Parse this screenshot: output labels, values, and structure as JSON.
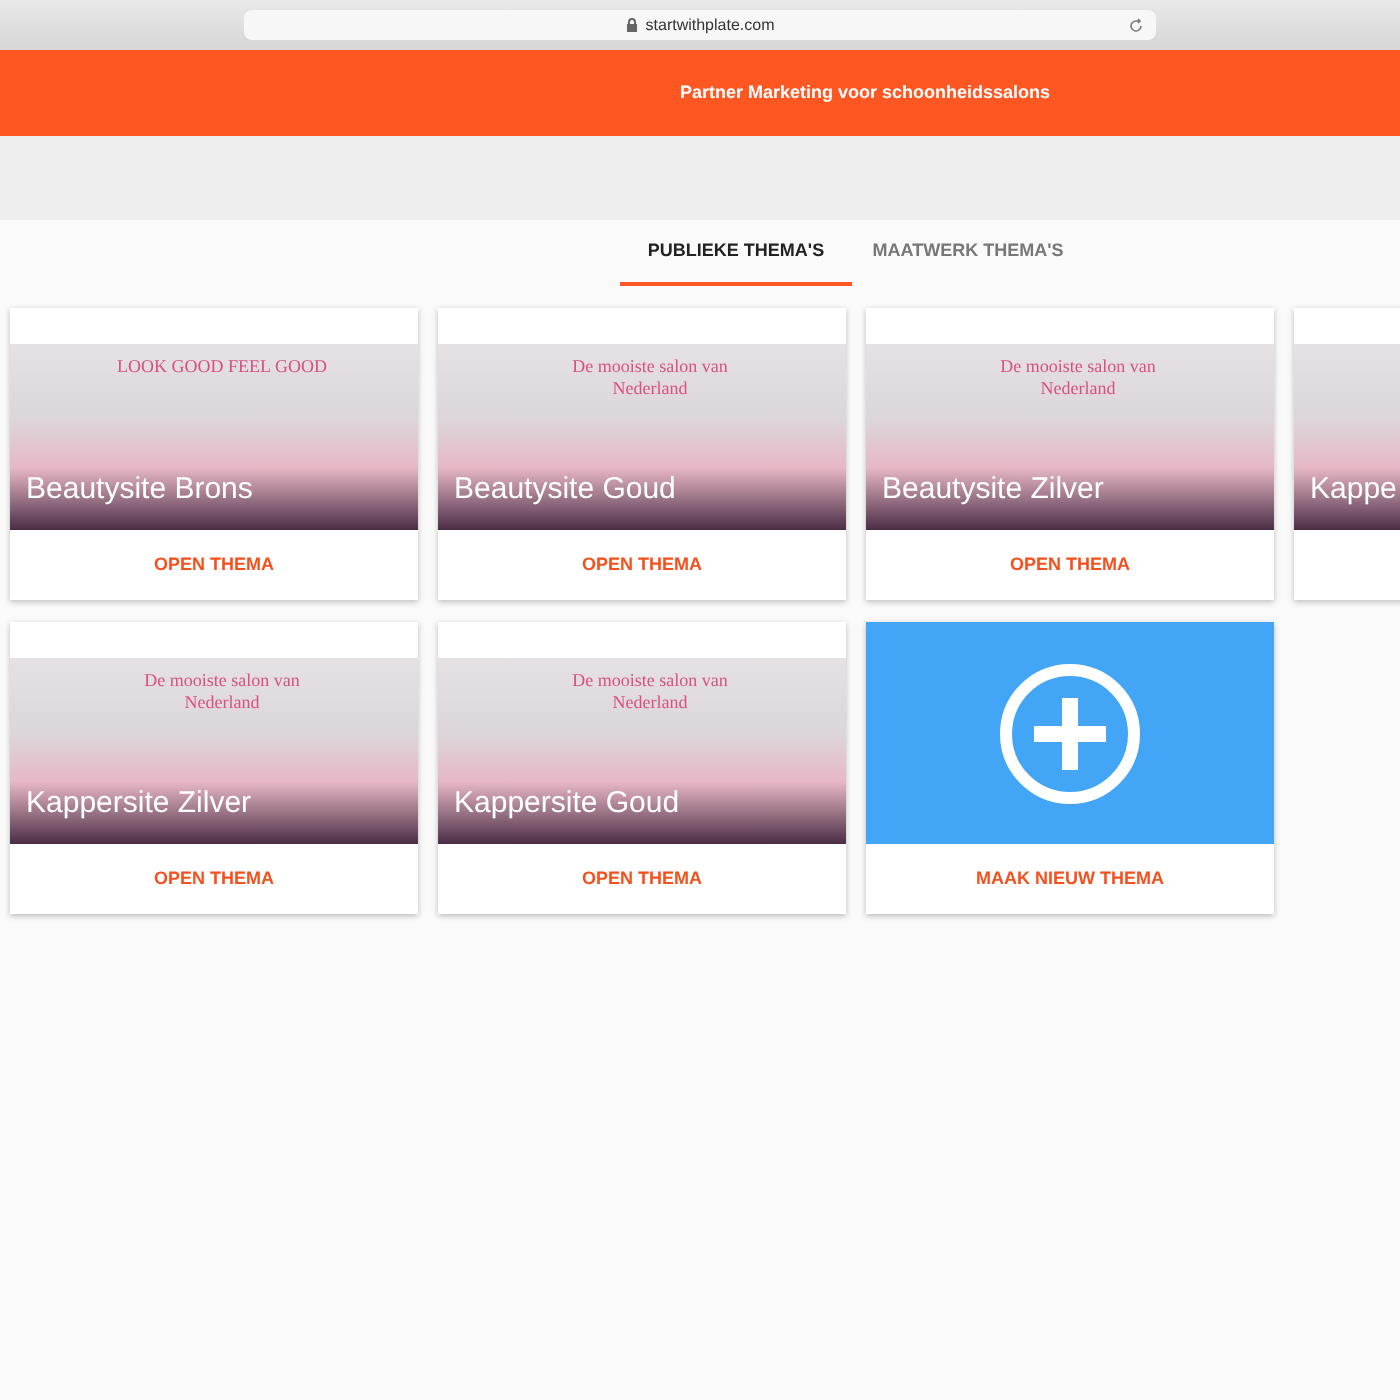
{
  "browser": {
    "url": "startwithplate.com"
  },
  "header": {
    "title": "Partner Marketing voor schoonheidssalons"
  },
  "tabs": [
    {
      "label": "PUBLIEKE THEMA'S",
      "selected": true
    },
    {
      "label": "MAATWERK THEMA'S",
      "selected": false
    }
  ],
  "cards": [
    {
      "kind": "theme",
      "headline": "LOOK GOOD FEEL GOOD",
      "title": "Beautysite Brons",
      "action": "OPEN THEMA"
    },
    {
      "kind": "theme",
      "headline": "De mooiste salon van Nederland",
      "title": "Beautysite Goud",
      "action": "OPEN THEMA"
    },
    {
      "kind": "theme",
      "headline": "De mooiste salon van Nederland",
      "title": "Beautysite Zilver",
      "action": "OPEN THEMA"
    },
    {
      "kind": "theme",
      "title": "Kappe"
    },
    {
      "kind": "theme",
      "headline": "De mooiste salon van Nederland",
      "title": "Kappersite Zilver",
      "action": "OPEN THEMA"
    },
    {
      "kind": "theme",
      "headline": "De mooiste salon van Nederland",
      "title": "Kappersite Goud",
      "action": "OPEN THEMA"
    },
    {
      "kind": "new",
      "action": "MAAK NIEUW THEMA"
    }
  ]
}
